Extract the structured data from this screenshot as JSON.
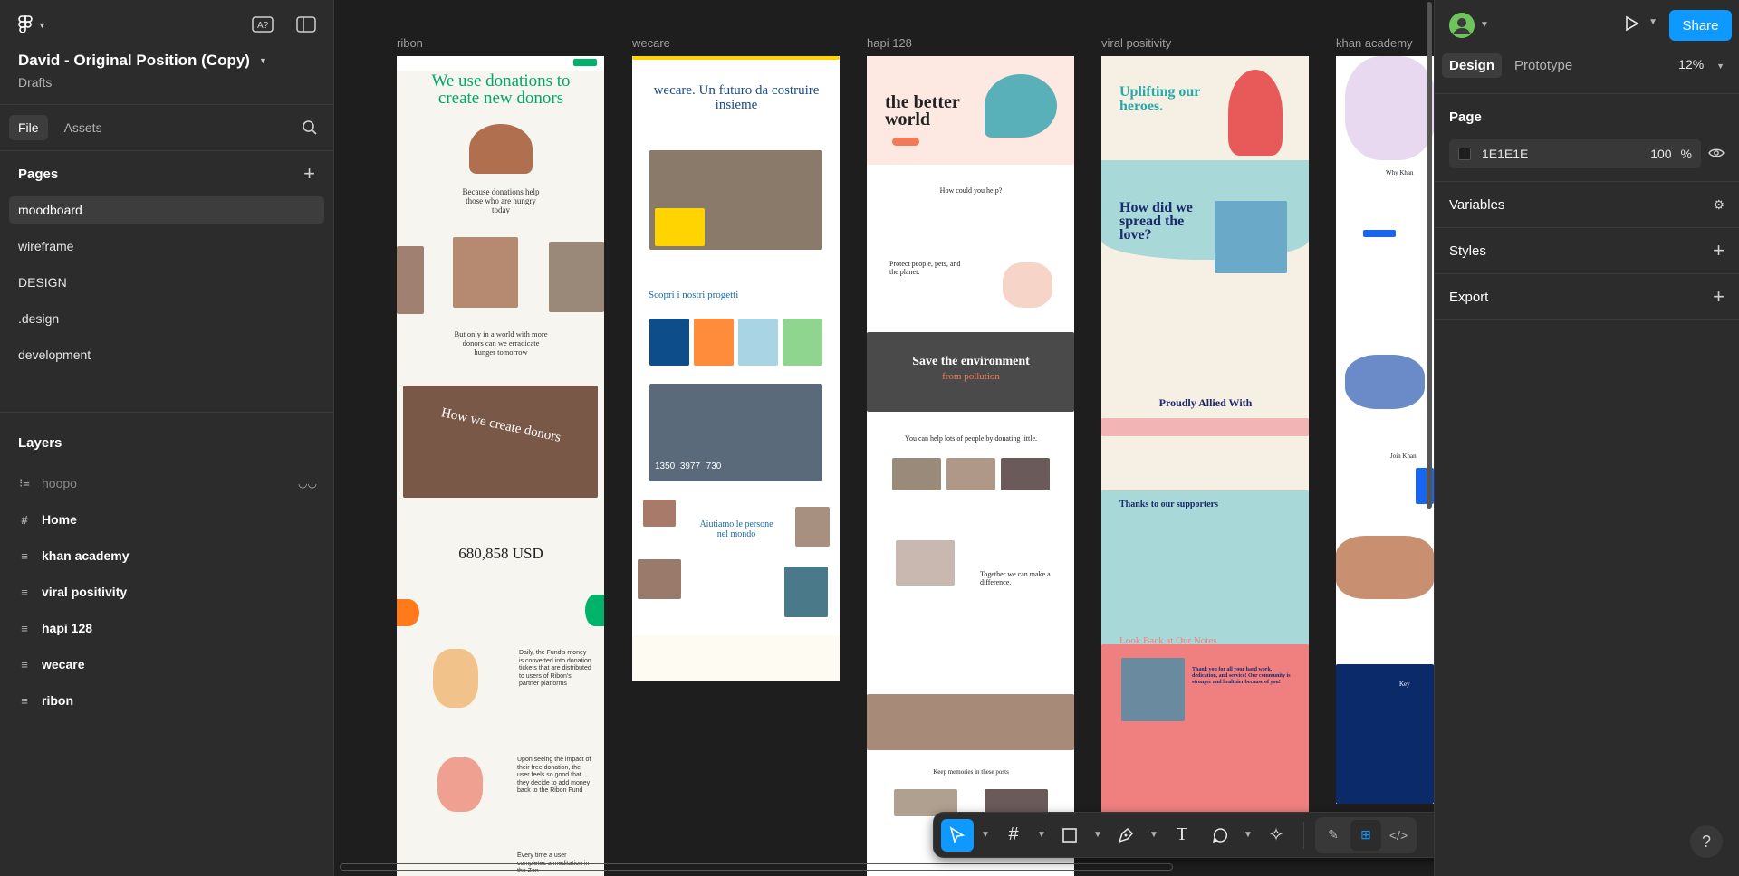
{
  "file": {
    "title": "David - Original Position (Copy)",
    "location": "Drafts"
  },
  "left_tabs": [
    "File",
    "Assets"
  ],
  "pages_header": "Pages",
  "pages": [
    "moodboard",
    "wireframe",
    "DESIGN",
    ".design",
    "development"
  ],
  "layers_header": "Layers",
  "layers": [
    {
      "name": "hoopo",
      "type": "frame-stack",
      "hidden": true
    },
    {
      "name": "Home",
      "type": "frame"
    },
    {
      "name": "khan academy",
      "type": "frame-stack"
    },
    {
      "name": "viral positivity",
      "type": "frame-stack"
    },
    {
      "name": "hapi 128",
      "type": "frame-stack"
    },
    {
      "name": "wecare",
      "type": "frame-stack"
    },
    {
      "name": "ribon",
      "type": "frame-stack"
    }
  ],
  "canvas": {
    "frames": [
      {
        "label": "ribon",
        "bg": "#f6f5ef"
      },
      {
        "label": "wecare",
        "bg": "#ffffff"
      },
      {
        "label": "hapi 128",
        "bg": "#ffffff"
      },
      {
        "label": "viral positivity",
        "bg": "#f5efe4"
      },
      {
        "label": "khan academy",
        "bg": "#ffffff"
      }
    ],
    "ribon_texts": {
      "headline": "We use donations to create new donors",
      "because": "Because donations help those who are hungry today",
      "but_only": "But only in a world with more donors can we erradicate hunger tomorrow",
      "how": "How we create donors",
      "amount": "680,858 USD",
      "daily": "Daily, the Fund's money is converted into donation tickets that are distributed to users of Ribon's partner platforms",
      "upon": "Upon seeing the impact of their free donation, the user feels so good that they decide to add money back to the Ribon Fund",
      "every": "Every time a user completes a meditation in the Zen"
    },
    "wecare_texts": {
      "headline": "wecare. Un futuro da costruire insieme",
      "progetti": "Scopri i nostri progetti",
      "aiutiamo": "Aiutiamo le persone nel mondo",
      "stats": [
        "1350",
        "3977",
        "730"
      ]
    },
    "hapi_texts": {
      "headline": "the better world",
      "how_help": "How could you help?",
      "protect": "Protect people, pets, and the planet.",
      "save": "Save the environment",
      "from": "from pollution",
      "you_can": "You can help lots of people by donating little.",
      "together": "Together we can make a difference.",
      "keep": "Keep memories in these posts"
    },
    "viral_texts": {
      "headline": "Uplifting our heroes.",
      "how_did": "How did we spread the love?",
      "allied": "Proudly Allied With",
      "thanks": "Thanks to our supporters",
      "look_back": "Look Back at Our Notes",
      "thank_you": "Thank you for all your hard work, dedication, and service! Our community is stronger and healthier because of you!"
    },
    "khan_texts": {
      "why": "Why Khan",
      "join": "Join Khan",
      "key": "Key"
    }
  },
  "toolbar": {
    "tools": [
      "move-tool",
      "frame-tool",
      "shape-tool",
      "pen-tool",
      "text-tool",
      "comment-tool",
      "actions-tool"
    ],
    "modes": [
      "draw-mode",
      "design-mode",
      "dev-mode"
    ]
  },
  "right": {
    "avatar_letter": "",
    "share_label": "Share",
    "tabs": [
      "Design",
      "Prototype"
    ],
    "zoom": "12%",
    "page_label": "Page",
    "page_fill": "1E1E1E",
    "page_opacity": "100",
    "pct": "%",
    "sections": [
      "Variables",
      "Styles",
      "Export"
    ]
  },
  "colors": {
    "accent": "#0d99ff",
    "canvas": "#1e1e1e",
    "panel": "#2c2c2c"
  }
}
